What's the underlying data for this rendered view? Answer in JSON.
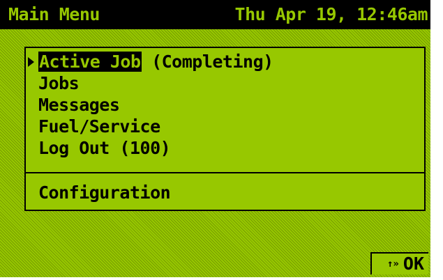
{
  "header": {
    "title": "Main Menu",
    "datetime": "Thu Apr 19, 12:46am"
  },
  "menu": {
    "items": [
      {
        "label": "Active Job",
        "suffix": " (Completing)"
      },
      {
        "label": "Jobs"
      },
      {
        "label": "Messages"
      },
      {
        "label": "Fuel/Service"
      },
      {
        "label": "Log Out (100)"
      }
    ],
    "config_label": "Configuration"
  },
  "footer": {
    "ok_icon": "↑»",
    "ok_label": "OK"
  },
  "colors": {
    "screen": "#97c800",
    "ink": "#000000"
  }
}
